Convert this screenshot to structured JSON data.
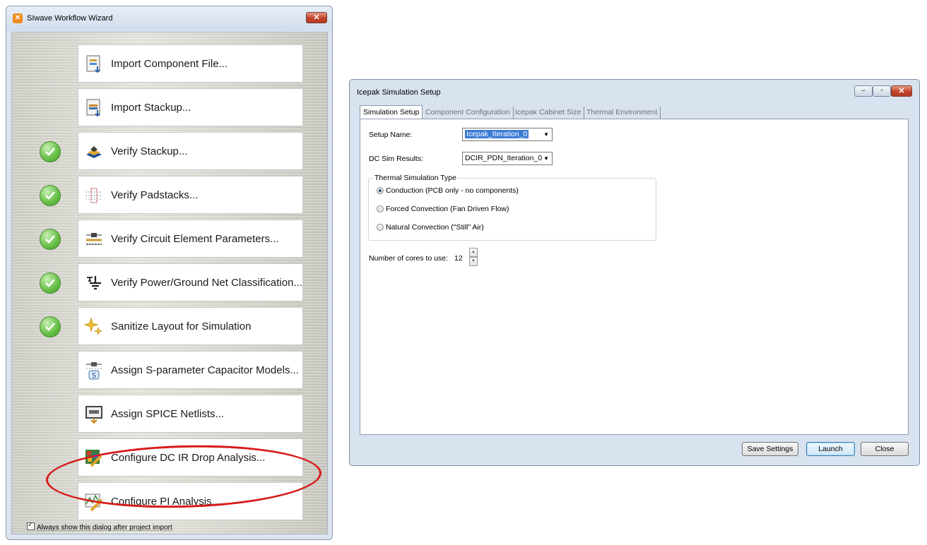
{
  "wizard": {
    "title": "SIwave Workflow Wizard",
    "app_icon": "siwave-app-icon",
    "close_label": "✕",
    "steps": [
      {
        "label": "Import Component File...",
        "done": false,
        "icon": "import-component-icon"
      },
      {
        "label": "Import Stackup...",
        "done": false,
        "icon": "import-stackup-icon"
      },
      {
        "label": "Verify Stackup...",
        "done": true,
        "icon": "stackup-layers-icon"
      },
      {
        "label": "Verify Padstacks...",
        "done": true,
        "icon": "padstack-icon"
      },
      {
        "label": "Verify Circuit Element Parameters...",
        "done": true,
        "icon": "circuit-element-icon"
      },
      {
        "label": "Verify Power/Ground Net Classification...",
        "done": true,
        "icon": "ground-symbol-icon"
      },
      {
        "label": "Sanitize Layout for Simulation",
        "done": true,
        "icon": "sparkle-icon"
      },
      {
        "label": "Assign S-parameter Capacitor Models...",
        "done": false,
        "icon": "s-parameter-icon"
      },
      {
        "label": "Assign SPICE Netlists...",
        "done": false,
        "icon": "spice-netlist-icon"
      },
      {
        "label": "Configure DC IR Drop Analysis...",
        "done": false,
        "icon": "dc-ir-drop-icon"
      },
      {
        "label": "Configure PI Analysis...",
        "done": false,
        "icon": "pi-analysis-icon"
      }
    ],
    "highlighted_step": "Configure DC IR Drop Analysis...",
    "highlight_color": "#d61b1b",
    "always_show_label": "Always show this dialog after project import",
    "always_show_checked": true
  },
  "icepak": {
    "title": "Icepak Simulation Setup",
    "tabs": [
      {
        "label": "Simulation Setup",
        "active": true
      },
      {
        "label": "Component Configuration",
        "active": false
      },
      {
        "label": "Icepak Cabinet Size",
        "active": false
      },
      {
        "label": "Thermal Environment",
        "active": false
      }
    ],
    "setup_name_label": "Setup Name:",
    "setup_name_value": "Icepak_Iteration_0",
    "dc_sim_label": "DC Sim Results:",
    "dc_sim_value": "DCIR_PDN_Iteration_0",
    "thermal_group_label": "Thermal Simulation Type",
    "thermal_options": [
      {
        "label": "Conduction (PCB only - no components)",
        "selected": true
      },
      {
        "label": "Forced Convection (Fan Driven Flow)",
        "selected": false
      },
      {
        "label": "Natural Convection (\"Still\" Air)",
        "selected": false
      }
    ],
    "cores_label": "Number of cores to use:",
    "cores_value": "12",
    "buttons": {
      "save": "Save Settings",
      "launch": "Launch",
      "close": "Close"
    }
  }
}
